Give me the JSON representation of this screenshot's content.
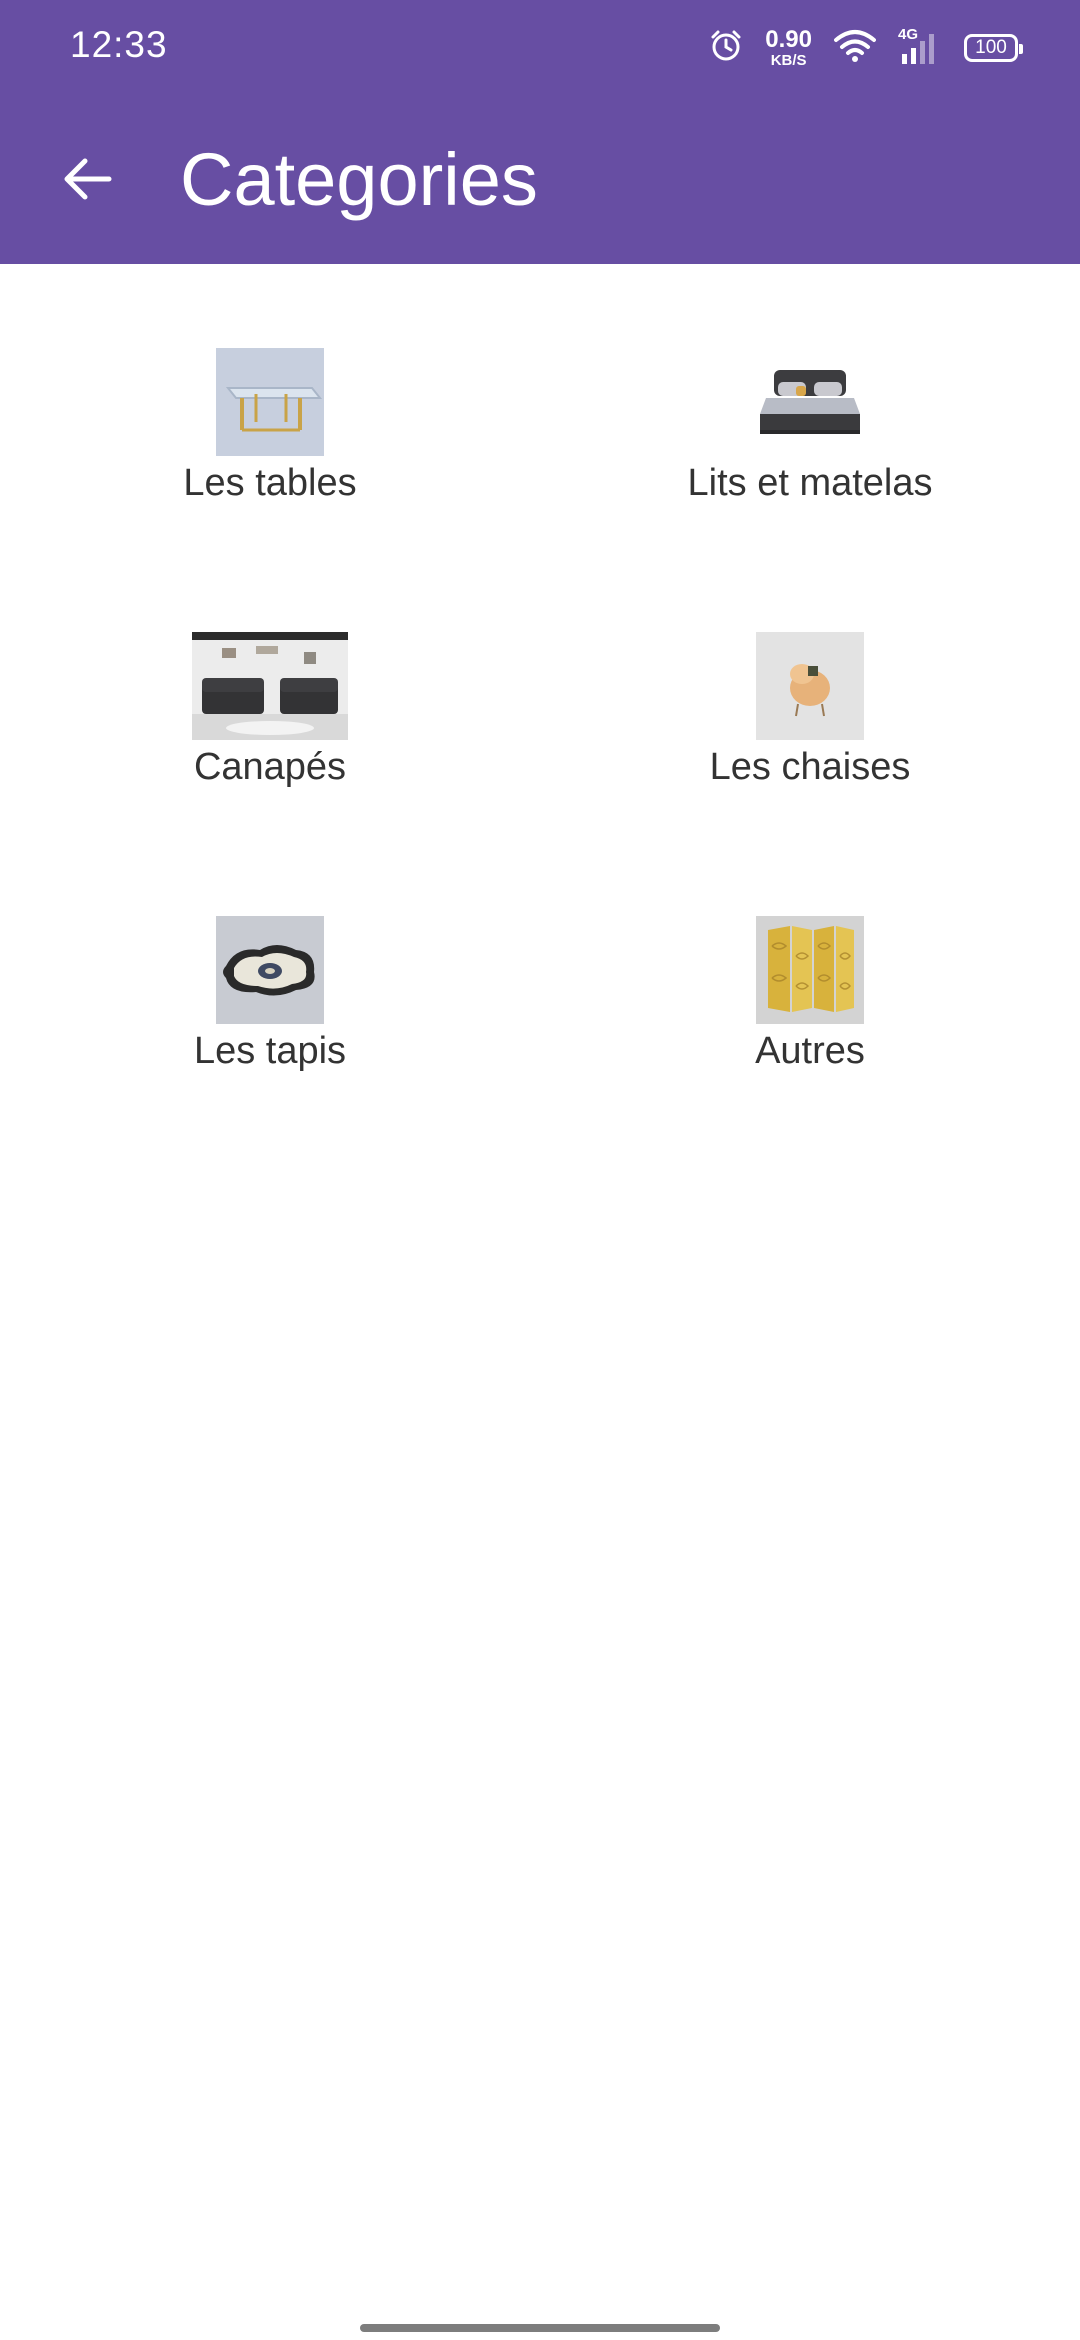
{
  "status_bar": {
    "time": "12:33",
    "net_speed_value": "0.90",
    "net_speed_unit": "KB/S",
    "network_type": "4G",
    "battery": "100",
    "icons": [
      "alarm-icon",
      "wifi-icon",
      "signal-icon",
      "battery-icon"
    ]
  },
  "app_bar": {
    "title": "Categories",
    "back_icon": "arrow-left-icon",
    "background": "#674ea3"
  },
  "categories": [
    {
      "label": "Les tables",
      "icon": "table-image"
    },
    {
      "label": "Lits et matelas",
      "icon": "bed-image"
    },
    {
      "label": "Canapés",
      "icon": "sofa-image"
    },
    {
      "label": "Les chaises",
      "icon": "chair-image"
    },
    {
      "label": "Les tapis",
      "icon": "rug-image"
    },
    {
      "label": "Autres",
      "icon": "folding-screen-image"
    }
  ]
}
